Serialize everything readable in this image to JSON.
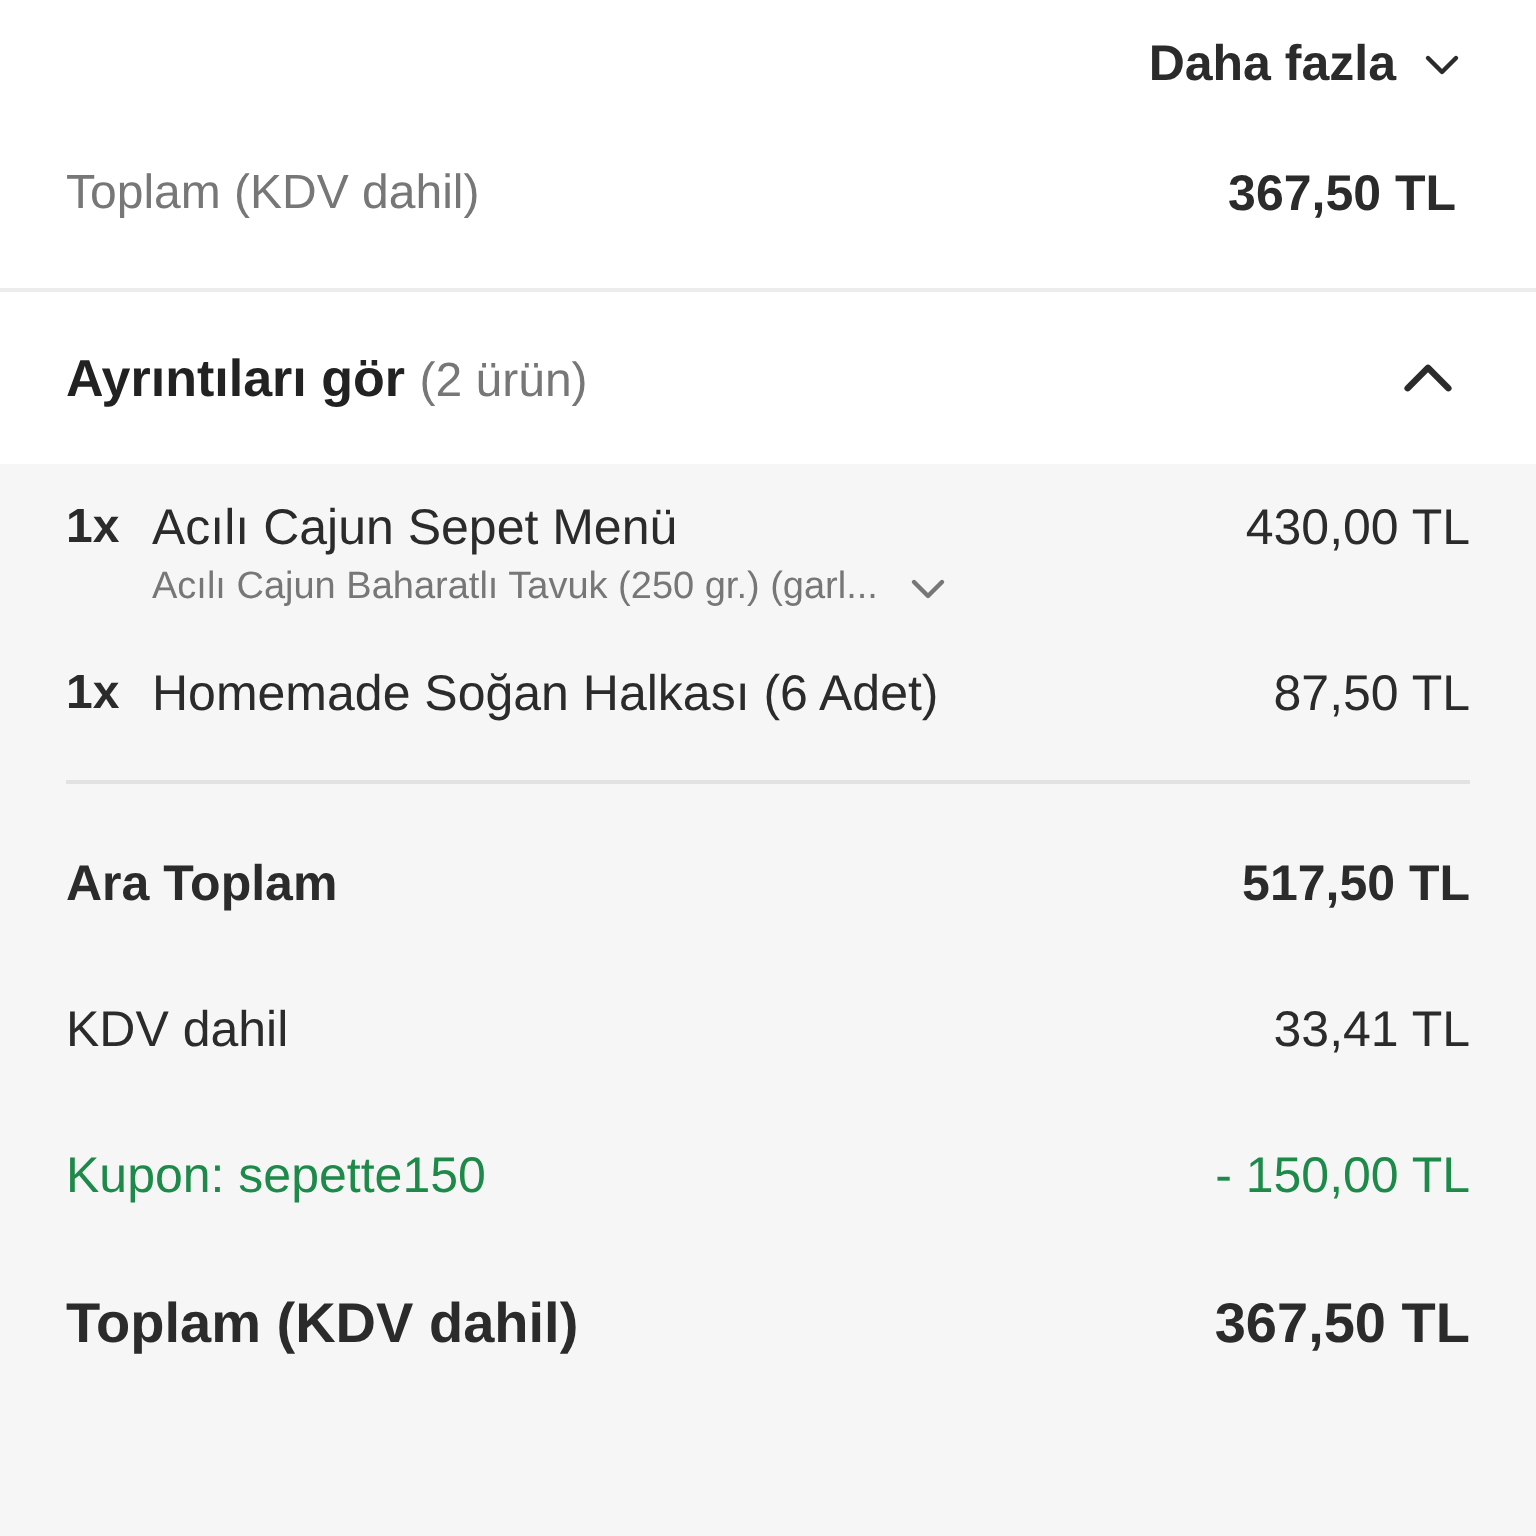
{
  "more": {
    "label": "Daha fazla",
    "expanded": false
  },
  "header_total": {
    "label": "Toplam (KDV dahil)",
    "value": "367,50 TL"
  },
  "details": {
    "title": "Ayrıntıları gör",
    "count": "(2 ürün)",
    "expanded": true
  },
  "items": [
    {
      "qty": "1x",
      "name": "Acılı Cajun Sepet Menü",
      "price": "430,00 TL",
      "subtitle": "Acılı Cajun Baharatlı Tavuk (250 gr.) (garl...",
      "expanded": false
    },
    {
      "qty": "1x",
      "name": "Homemade Soğan Halkası (6 Adet)",
      "price": "87,50 TL"
    }
  ],
  "summary": [
    {
      "kind": "subtotal",
      "label": "Ara Toplam",
      "value": "517,50 TL"
    },
    {
      "kind": "tax",
      "label": "KDV dahil",
      "value": "33,41 TL"
    },
    {
      "kind": "coupon",
      "label": "Kupon: sepette150",
      "value": "- 150,00 TL"
    },
    {
      "kind": "total",
      "label": "Toplam (KDV dahil)",
      "value": "367,50 TL"
    }
  ]
}
